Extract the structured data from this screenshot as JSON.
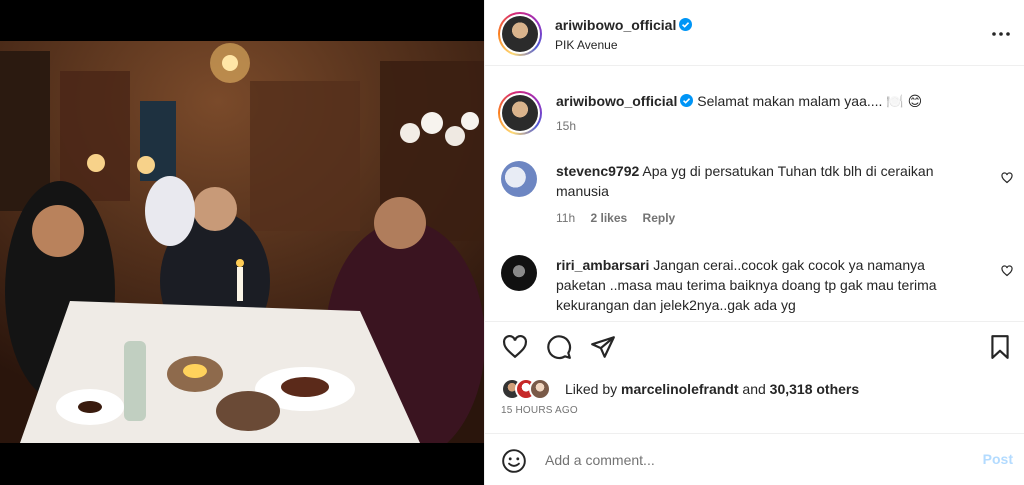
{
  "post": {
    "username": "ariwibowo_official",
    "location": "PIK Avenue",
    "verified": true
  },
  "caption": {
    "username": "ariwibowo_official",
    "text": "Selamat makan malam yaa.... 🍽️ 😊",
    "age": "15h"
  },
  "comments": [
    {
      "username": "stevenc9792",
      "text": "Apa yg di persatukan Tuhan tdk blh di ceraikan manusia",
      "age": "11h",
      "likes": "2 likes",
      "reply_label": "Reply"
    },
    {
      "username": "riri_ambarsari",
      "text": "Jangan cerai..cocok gak cocok ya namanya paketan ..masa mau terima baiknya doang tp gak mau terima kekurangan dan jelek2nya..gak ada yg"
    }
  ],
  "likes": {
    "prefix": "Liked by",
    "user": "marcelinolefrandt",
    "joiner": "and",
    "others": "30,318 others"
  },
  "timestamp": "15 HOURS AGO",
  "comment_box": {
    "placeholder": "Add a comment...",
    "post_label": "Post"
  },
  "icons": {
    "more": "more-horizontal-icon",
    "like": "heart-icon",
    "comment": "comment-bubble-icon",
    "share": "paper-plane-icon",
    "save": "bookmark-icon",
    "emoji": "smiley-icon",
    "verified": "verified-badge-icon"
  },
  "colors": {
    "verified_blue": "#0095f6",
    "muted_text": "#737373",
    "post_disabled": "#b3dbff",
    "divider": "#efefef"
  }
}
